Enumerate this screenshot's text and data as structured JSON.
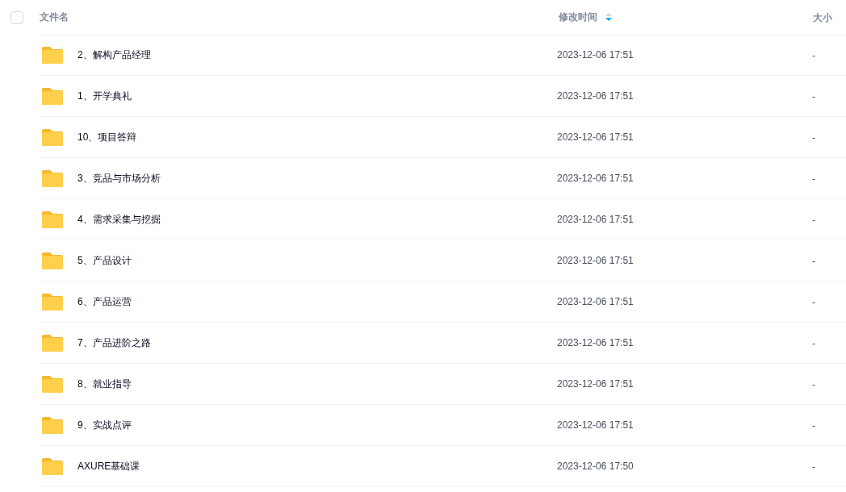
{
  "header": {
    "select_all": {
      "checked": false
    },
    "columns": [
      {
        "label": "文件名"
      },
      {
        "label": "修改时间",
        "sort_descending": true
      },
      {
        "label": "大小"
      }
    ]
  },
  "rows": [
    {
      "name": "2、解构产品经理",
      "modified": "2023-12-06 17:51",
      "size": "-"
    },
    {
      "name": "1、开学典礼",
      "modified": "2023-12-06 17:51",
      "size": "-"
    },
    {
      "name": "10、项目答辩",
      "modified": "2023-12-06 17:51",
      "size": "-"
    },
    {
      "name": "3、竞品与市场分析",
      "modified": "2023-12-06 17:51",
      "size": "-"
    },
    {
      "name": "4、需求采集与挖掘",
      "modified": "2023-12-06 17:51",
      "size": "-"
    },
    {
      "name": "5、产品设计",
      "modified": "2023-12-06 17:51",
      "size": "-"
    },
    {
      "name": "6、产品运营",
      "modified": "2023-12-06 17:51",
      "size": "-"
    },
    {
      "name": "7、产品进阶之路",
      "modified": "2023-12-06 17:51",
      "size": "-"
    },
    {
      "name": "8、就业指导",
      "modified": "2023-12-06 17:51",
      "size": "-"
    },
    {
      "name": "9、实战点评",
      "modified": "2023-12-06 17:51",
      "size": "-"
    },
    {
      "name": "AXURE基础课",
      "modified": "2023-12-06 17:50",
      "size": "-"
    }
  ]
}
